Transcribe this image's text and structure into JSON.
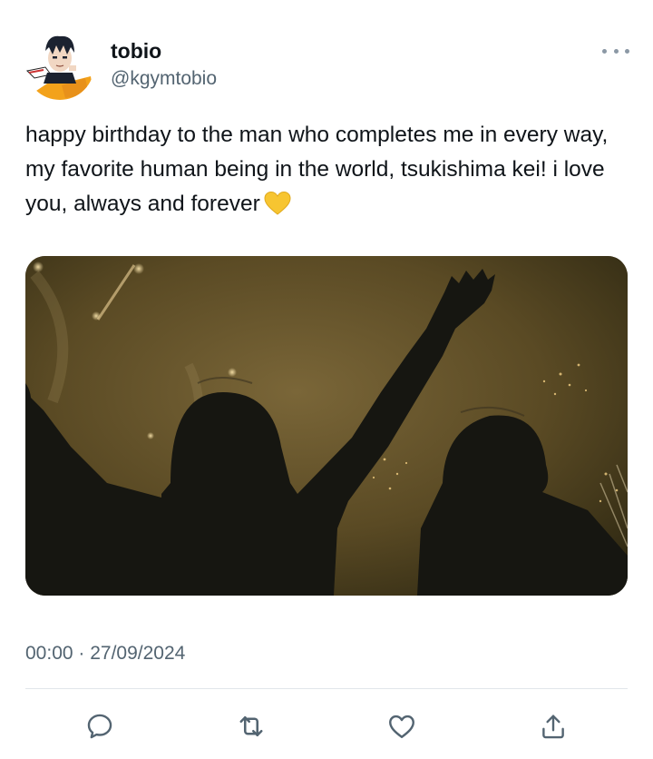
{
  "author": {
    "display_name": "tobio",
    "handle": "@kgymtobio"
  },
  "tweet": {
    "text": "happy birthday to the man who completes me in every way, my favorite human being in the world, tsukishima kei! i love you, always and forever",
    "emoji": "yellow-heart"
  },
  "media": {
    "subject": "two-silhouettes-fireworks"
  },
  "meta": {
    "timestamp": "00:00 · 27/09/2024"
  },
  "actions": [
    {
      "icon": "reply-icon"
    },
    {
      "icon": "retweet-icon"
    },
    {
      "icon": "like-icon"
    },
    {
      "icon": "share-icon"
    }
  ],
  "colors": {
    "text": "#0f1419",
    "secondary": "#536471",
    "divider": "#e1e6ea",
    "heart": "#f7c531"
  }
}
